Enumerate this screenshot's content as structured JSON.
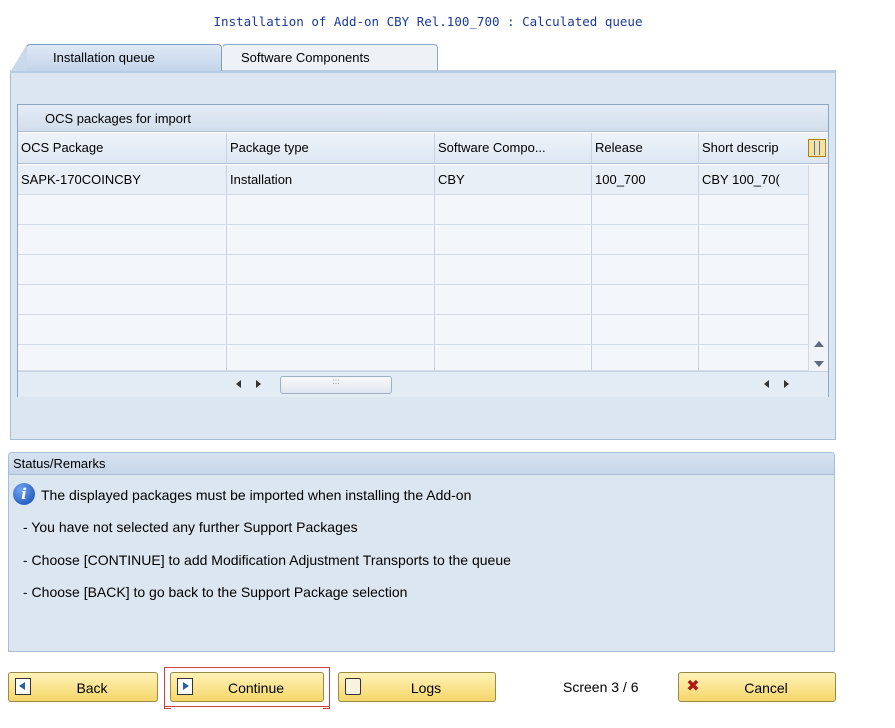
{
  "window": {
    "title": "Installation of Add-on CBY Rel.100_700 : Calculated queue"
  },
  "tabs": [
    {
      "label": "Installation queue",
      "active": true
    },
    {
      "label": "Software Components",
      "active": false
    }
  ],
  "table": {
    "caption": "OCS packages for import",
    "columns": [
      "OCS Package",
      "Package type",
      "Software Compo...",
      "Release",
      "Short descrip"
    ],
    "rows": [
      [
        "SAPK-170COINCBY",
        "Installation",
        "CBY",
        "100_700",
        "CBY 100_70("
      ]
    ],
    "empty_rows": 6
  },
  "status": {
    "header": "Status/Remarks",
    "message": "The displayed packages must be imported when installing the Add-on",
    "lines": [
      "- You have not selected any further Support Packages",
      "- Choose [CONTINUE] to add Modification Adjustment Transports to the queue",
      "- Choose [BACK] to go back to the Support Package selection"
    ]
  },
  "buttons": {
    "back": "Back",
    "continue": "Continue",
    "logs": "Logs",
    "cancel": "Cancel"
  },
  "screen_indicator": "Screen 3 / 6",
  "colors": {
    "title_text": "#1a3a9c",
    "panel_bg": "#dce6f1",
    "button_bg": "#f5d66a",
    "focus_bracket": "#d04040"
  },
  "icons": {
    "info": "info-icon",
    "column_config": "column-settings-icon",
    "back": "back-nav-icon",
    "continue": "continue-nav-icon",
    "logs": "log-icon",
    "cancel": "cancel-x-icon"
  }
}
